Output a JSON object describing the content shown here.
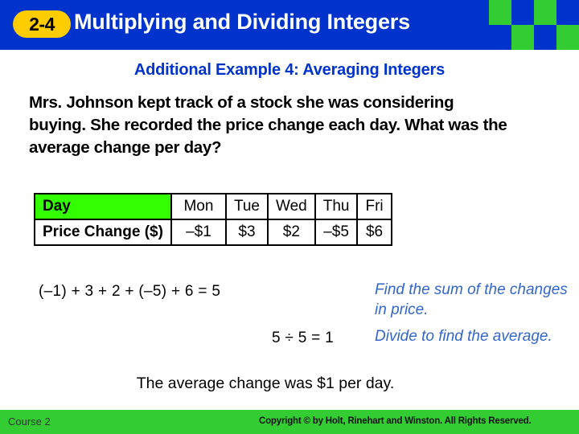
{
  "header": {
    "lesson_number": "2-4",
    "title": "Multiplying and Dividing Integers",
    "badge_color": "#ffcc00",
    "bar_color": "#0033cc",
    "check_color": "#33cc33"
  },
  "slide": {
    "example_title": "Additional Example 4: Averaging Integers",
    "problem_text": "Mrs. Johnson kept track of a stock she was considering buying. She recorded the price change each day. What was the average change per day?",
    "title_color": "#0033cc"
  },
  "table": {
    "row_label_1": "Day",
    "row_label_2": "Price Change ($)",
    "days": [
      "Mon",
      "Tue",
      "Wed",
      "Thu",
      "Fri"
    ],
    "changes": [
      "–$1",
      "$3",
      "$2",
      "–$5",
      "$6"
    ],
    "header_highlight_color": "#33ff00"
  },
  "work": {
    "sum_line": "(–1) + 3 + 2 + (–5) + 6 = 5",
    "divide_line": "5 ÷ 5 = 1",
    "note_sum": "Find the sum of the changes in price.",
    "note_divide": "Divide to find the average.",
    "conclusion": "The average change was $1 per day.",
    "note_color": "#3366cc"
  },
  "footer": {
    "course": "Course 2",
    "copyright": "Copyright © by Holt, Rinehart and Winston. All Rights Reserved.",
    "background_color": "#33cc33"
  }
}
